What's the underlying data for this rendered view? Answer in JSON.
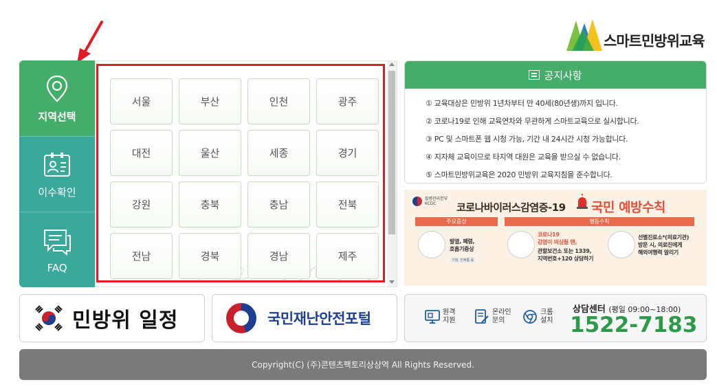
{
  "logo": {
    "text": "스마트민방위교육"
  },
  "left_menu": {
    "items": [
      {
        "label": "지역선택",
        "icon": "location-pin-icon"
      },
      {
        "label": "이수확인",
        "icon": "id-card-icon"
      },
      {
        "label": "FAQ",
        "icon": "chat-bubble-icon"
      }
    ]
  },
  "regions": [
    "서울",
    "부산",
    "인천",
    "광주",
    "대전",
    "울산",
    "세종",
    "경기",
    "강원",
    "충북",
    "충남",
    "전북",
    "전남",
    "경북",
    "경남",
    "제주"
  ],
  "notice": {
    "title": "공지사항",
    "items": [
      "① 교육대상은 민방위 1년차부터 만 40세(80년생)까지 입니다.",
      "② 코로나19로 인해 교육연차와 무관하게 스마트교육으로 실시합니다.",
      "③ PC 및 스마트폰 웹 시청 가능, 기간 내 24시간 시청 가능합니다.",
      "④ 지자체 교육이므로 타지역 대원은 교육을 받으실 수 없습니다.",
      "⑤ 스마트민방위교육은 2020 민방위 교육지침을 준수합니다."
    ]
  },
  "banner": {
    "agency_line1": "질병관리본부",
    "agency_line2": "KCDC",
    "title": "코로나바이러스감염증-19",
    "slogan": "국민 예방수칙",
    "tag_symptoms": "주요증상",
    "tag_rules": "행동수칙",
    "symptoms_text": [
      "발열, 폐렴,",
      "호흡기증상"
    ],
    "symptoms_small": "기침, 인후통 등",
    "rule1_red": [
      "코로나19",
      "감염이 의심될 땐,"
    ],
    "rule1_text": [
      "관할보건소 또는 1339,",
      "지역번호+120 상담하기"
    ],
    "rule2_text": [
      "선별진료소*(의료기관)",
      "방문 시, 의료진에게",
      "해외여행력 알리기"
    ]
  },
  "bottom": {
    "schedule_label": "민방위 일정",
    "portal_label": "국민재난안전포털"
  },
  "support": {
    "remote": [
      "원격",
      "지원"
    ],
    "online": [
      "온라인",
      "문의"
    ],
    "chrome": [
      "크롬",
      "설치"
    ],
    "center_title": "상담센터",
    "center_hours": "(평일 09:00~18:00)",
    "phone": "1522-7183"
  },
  "footer": {
    "text": "Copyright(C) (주)콘텐츠팩토리상상역   All Rights Reserved."
  }
}
